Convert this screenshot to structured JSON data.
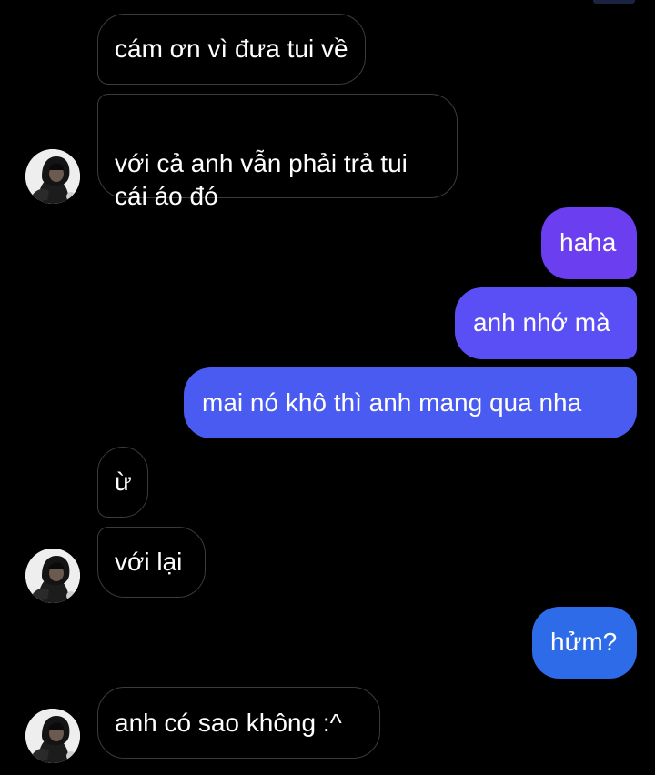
{
  "colors": {
    "background": "#000000",
    "incoming_border": "#3b3b3b",
    "outgoing_purple": "#6b3ef0",
    "outgoing_indigo": "#5a4ef5",
    "outgoing_blue": "#4a5bf2",
    "outgoing_bright_blue": "#2e6be9"
  },
  "contact": {
    "avatar_icon": "hooded-person-avatar-icon"
  },
  "messages": [
    {
      "direction": "in",
      "text": "cám ơn vì đưa tui về"
    },
    {
      "direction": "in",
      "text": "với cả anh vẫn phải trả tui\ncái áo đó"
    },
    {
      "direction": "out",
      "text": "haha"
    },
    {
      "direction": "out",
      "text": "anh nhớ mà"
    },
    {
      "direction": "out",
      "text": "mai nó khô thì anh mang qua nha"
    },
    {
      "direction": "in",
      "text": "ừ"
    },
    {
      "direction": "in",
      "text": "với lại"
    },
    {
      "direction": "out",
      "text": "hửm?"
    },
    {
      "direction": "in",
      "text": "anh có sao không :^"
    }
  ]
}
